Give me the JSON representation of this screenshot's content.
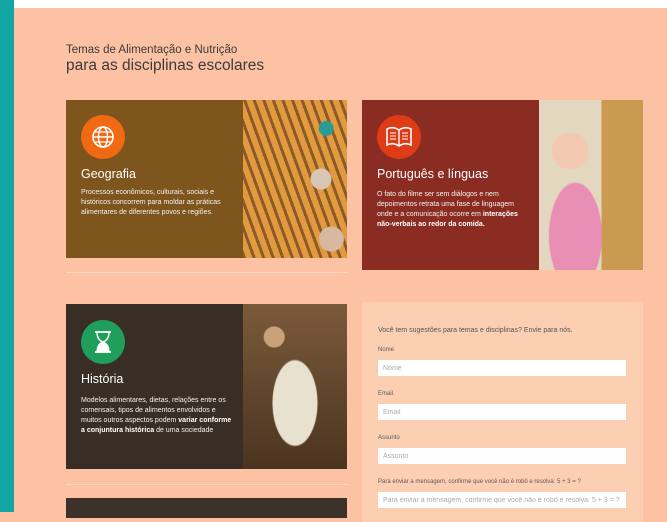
{
  "colors": {
    "background": "#fdc2a3",
    "stripe": "#14a6a3"
  },
  "section": {
    "title_line1": "Temas de Alimentação e Nutrição",
    "title_line2": "para as disciplinas escolares"
  },
  "cards": [
    {
      "title": "Geografia",
      "icon": "globe-icon",
      "color": "#ef6a13",
      "description": "Processos econômicos, culturais, sociais e históricos concorrem para moldar as práticas alimentares de diferentes povos e regiões."
    },
    {
      "title": "Português e línguas",
      "icon": "open-book-icon",
      "color": "#de3c17",
      "description_plain": "O fato do filme ser sem diálogos e nem depoimentos retrata uma fase de linguagem onde e a comunicação ocorre em",
      "description_bold": "interações não-verbais ao redor da comida."
    },
    {
      "title": "História",
      "icon": "hourglass-icon",
      "color": "#1f9e5c",
      "description_plain": "Modelos alimentares, dietas, relações entre os comensais, tipos de alimentos envolvidos e muitos outros aspectos podem",
      "description_bold": "variar conforme a conjuntura histórica",
      "description_tail": "de uma sociedade"
    }
  ],
  "form": {
    "heading": "Você tem sugestões para temas e disciplinas? Envie para nós.",
    "fields": [
      {
        "label": "Nome",
        "placeholder": "Nome"
      },
      {
        "label": "Email",
        "placeholder": "Email"
      },
      {
        "label": "Assunto",
        "placeholder": "Assunto"
      },
      {
        "label": "Para enviar a mensagem, confirme que você não é robô e resolva: 5 + 3 = ?",
        "placeholder": "Para enviar a mensagem, confirme que você não é robô e resolva: 5 + 3 = ?"
      }
    ]
  }
}
